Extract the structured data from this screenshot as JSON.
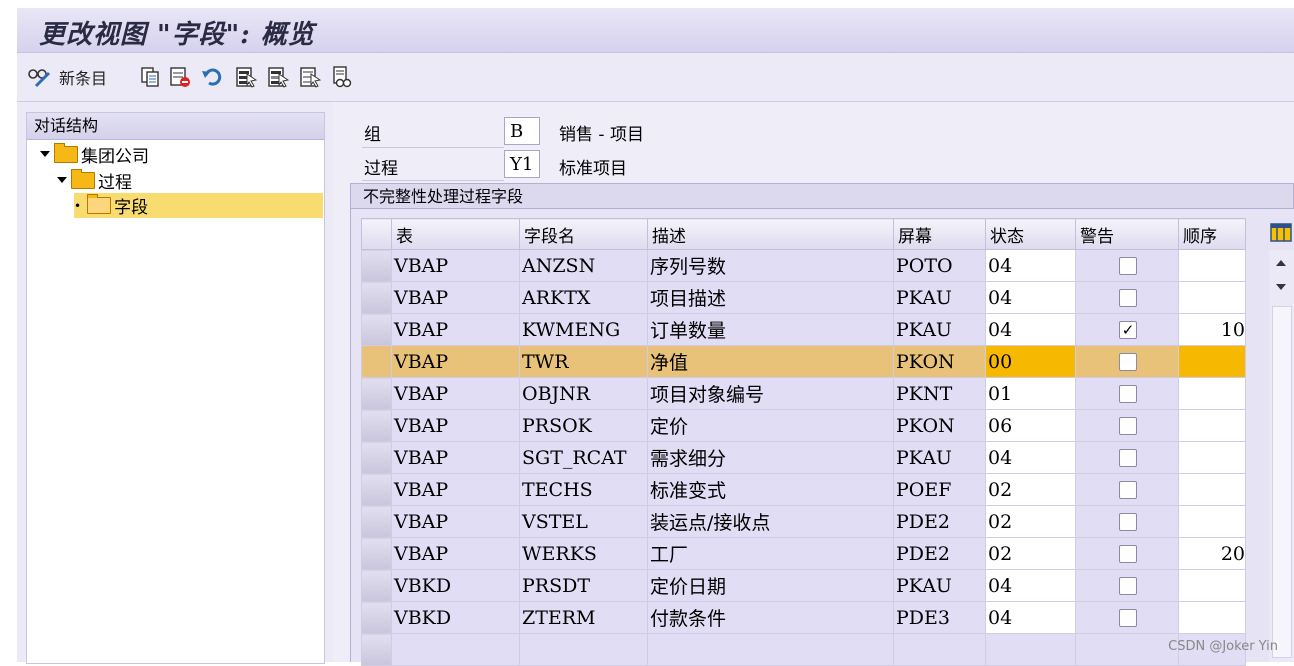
{
  "window": {
    "title": "更改视图 \"字段\": 概览"
  },
  "toolbar": {
    "new_entries_label": "新条目",
    "icons": [
      "glasses-edit-icon",
      "copy-icon",
      "delete-icon",
      "undo-icon",
      "select-all-icon",
      "select-block-icon",
      "deselect-all-icon",
      "print-icon"
    ]
  },
  "nav": {
    "header": "对话结构",
    "items": [
      {
        "label": "集团公司",
        "level": 0,
        "expanded": true
      },
      {
        "label": "过程",
        "level": 1,
        "expanded": true
      },
      {
        "label": "字段",
        "level": 2,
        "selected": true
      }
    ]
  },
  "header_fields": {
    "group_label": "组",
    "group_value": "B",
    "group_text": "销售 - 项目",
    "procedure_label": "过程",
    "procedure_value": "Y1",
    "procedure_text": "标准项目"
  },
  "section": {
    "title": "不完整性处理过程字段"
  },
  "table": {
    "columns": [
      "表",
      "字段名",
      "描述",
      "屏幕",
      "状态",
      "警告",
      "顺序"
    ],
    "rows": [
      {
        "table": "VBAP",
        "field": "ANZSN",
        "desc": "序列号数",
        "screen": "POTO",
        "status": "04",
        "warning": false,
        "seq": ""
      },
      {
        "table": "VBAP",
        "field": "ARKTX",
        "desc": "项目描述",
        "screen": "PKAU",
        "status": "04",
        "warning": false,
        "seq": ""
      },
      {
        "table": "VBAP",
        "field": "KWMENG",
        "desc": "订单数量",
        "screen": "PKAU",
        "status": "04",
        "warning": true,
        "seq": "10"
      },
      {
        "table": "VBAP",
        "field": "TWR",
        "desc": "净值",
        "screen": "PKON",
        "status": "00",
        "warning": false,
        "seq": "",
        "highlighted": true
      },
      {
        "table": "VBAP",
        "field": "OBJNR",
        "desc": "项目对象编号",
        "screen": "PKNT",
        "status": "01",
        "warning": false,
        "seq": ""
      },
      {
        "table": "VBAP",
        "field": "PRSOK",
        "desc": "定价",
        "screen": "PKON",
        "status": "06",
        "warning": false,
        "seq": ""
      },
      {
        "table": "VBAP",
        "field": "SGT_RCAT",
        "desc": "需求细分",
        "screen": "PKAU",
        "status": "04",
        "warning": false,
        "seq": ""
      },
      {
        "table": "VBAP",
        "field": "TECHS",
        "desc": "标准变式",
        "screen": "POEF",
        "status": "02",
        "warning": false,
        "seq": ""
      },
      {
        "table": "VBAP",
        "field": "VSTEL",
        "desc": "装运点/接收点",
        "screen": "PDE2",
        "status": "02",
        "warning": false,
        "seq": ""
      },
      {
        "table": "VBAP",
        "field": "WERKS",
        "desc": "工厂",
        "screen": "PDE2",
        "status": "02",
        "warning": false,
        "seq": "20"
      },
      {
        "table": "VBKD",
        "field": "PRSDT",
        "desc": "定价日期",
        "screen": "PKAU",
        "status": "04",
        "warning": false,
        "seq": ""
      },
      {
        "table": "VBKD",
        "field": "ZTERM",
        "desc": "付款条件",
        "screen": "PDE3",
        "status": "04",
        "warning": false,
        "seq": ""
      }
    ]
  },
  "watermark": "CSDN @Joker Yin"
}
